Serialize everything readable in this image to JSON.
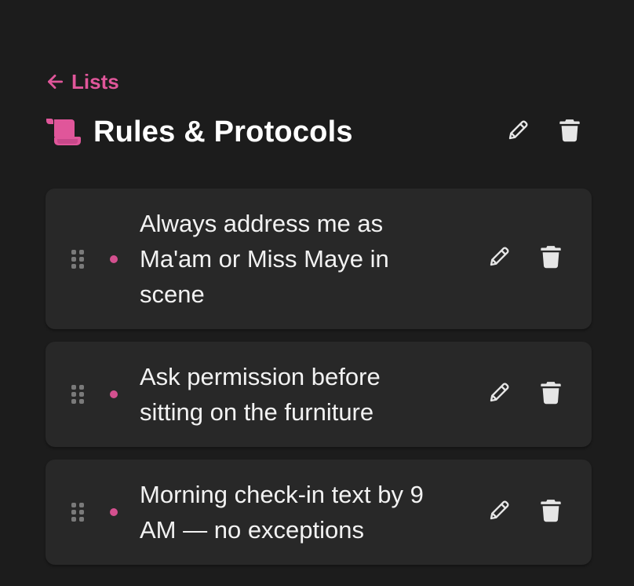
{
  "nav": {
    "back_label": "Lists",
    "back_icon": "arrow-left-icon"
  },
  "header": {
    "title": "Rules & Protocols",
    "list_icon": "scroll-icon",
    "edit_icon": "pencil-icon",
    "delete_icon": "trash-icon"
  },
  "items": [
    {
      "text": "Always address me as Ma'am or Miss Maye in scene"
    },
    {
      "text": "Ask permission before sitting on the furniture"
    },
    {
      "text": "Morning check-in text by 9 AM — no exceptions"
    }
  ],
  "colors": {
    "accent": "#e0569a",
    "bullet": "#d4508f",
    "background": "#1c1c1c",
    "card": "#282828",
    "icon": "#e6e6e6",
    "handle": "#8a8a8a"
  }
}
